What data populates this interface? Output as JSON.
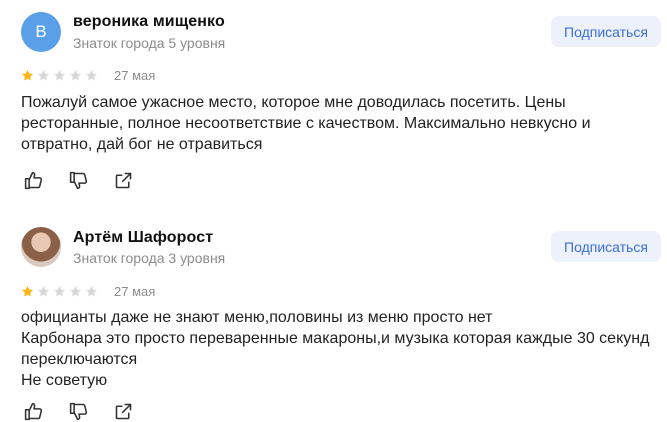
{
  "reviews": [
    {
      "avatar_letter": "В",
      "name": "вероника мищенко",
      "level": "Знаток города 5 уровня",
      "subscribe_label": "Подписаться",
      "rating": 1,
      "date": "27 мая",
      "lines": [
        "Пожалуй самое ужасное место, которое мне доводилась посетить. Цены",
        "ресторанные, полное несоответствие с качеством. Максимально невкусно и",
        "отвратно, дай бог не отравиться"
      ]
    },
    {
      "avatar_letter": "",
      "name": "Артём Шафорост",
      "level": "Знаток города 3 уровня",
      "subscribe_label": "Подписаться",
      "rating": 1,
      "date": "27 мая",
      "lines": [
        "официанты даже не знают меню,половины из меню просто нет",
        "Карбонара это просто переваренные макароны,и музыка которая каждые 30 секунд",
        "переключаются",
        "Не советую"
      ]
    }
  ],
  "colors": {
    "star_filled": "#fbb514",
    "star_empty": "#d8d8d8",
    "accent": "#3b6fd9",
    "icon": "#333333"
  },
  "icons": [
    "like-icon",
    "dislike-icon",
    "share-icon"
  ]
}
